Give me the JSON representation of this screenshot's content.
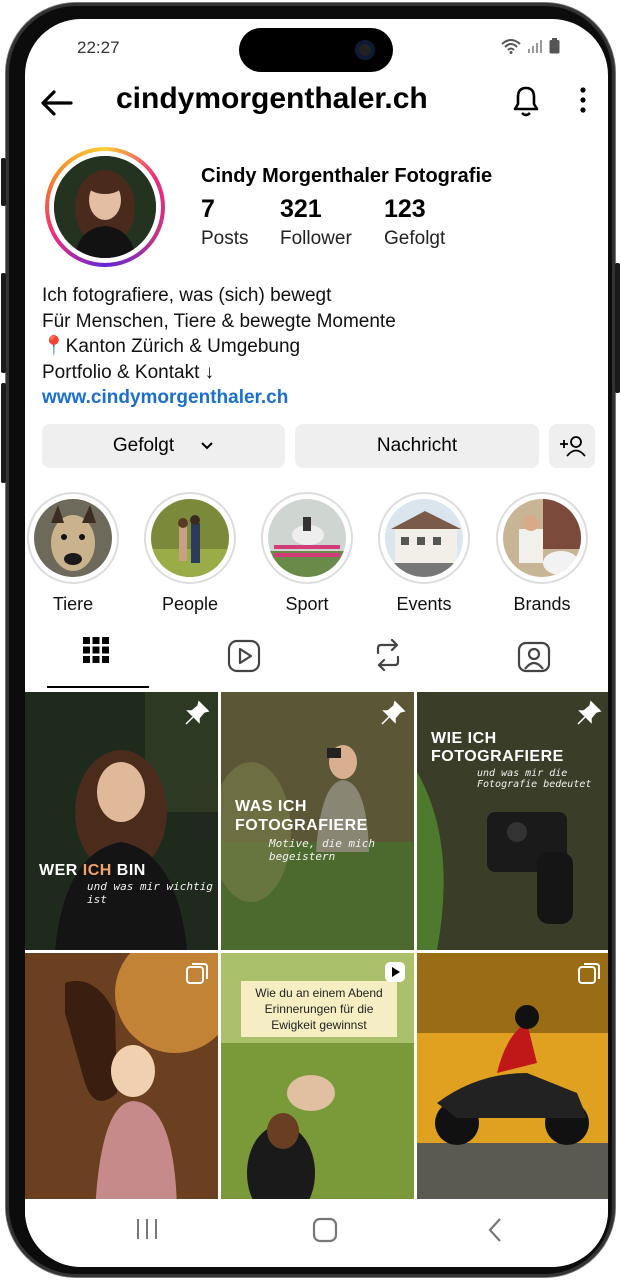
{
  "status": {
    "time": "22:27"
  },
  "header": {
    "username": "cindymorgenthaler.ch"
  },
  "profile": {
    "display_name": "Cindy Morgenthaler Fotografie",
    "stats": [
      {
        "value": "7",
        "label": "Posts"
      },
      {
        "value": "321",
        "label": "Follower"
      },
      {
        "value": "123",
        "label": "Gefolgt"
      }
    ],
    "bio": [
      "Ich fotografiere, was (sich) bewegt",
      "Für Menschen, Tiere & bewegte Momente",
      "📍Kanton Zürich & Umgebung",
      "Portfolio & Kontakt ↓"
    ],
    "link": "www.cindymorgenthaler.ch"
  },
  "actions": {
    "follow_label": "Gefolgt",
    "message_label": "Nachricht"
  },
  "highlights": [
    {
      "label": "Tiere"
    },
    {
      "label": "People"
    },
    {
      "label": "Sport"
    },
    {
      "label": "Events"
    },
    {
      "label": "Brands"
    }
  ],
  "posts": {
    "p2_title_a": "WER ",
    "p2_title_b": "ICH",
    "p2_title_c": " BIN",
    "p2_sub": "und was mir wichtig ist",
    "p3_title_a": "WAS ICH",
    "p3_title_b": "FOTOGRAFIERE",
    "p3_sub": "Motive, die mich begeistern",
    "p4_title_a": "WIE ICH",
    "p4_title_b": "FOTOGRAFIERE",
    "p4_sub": "und was mir die Fotografie bedeutet",
    "p5_caption": "Wie du an einem Abend Erinnerungen für die Ewigkeit gewinnst"
  },
  "colors": {
    "link": "#1a6fd0",
    "accent": "#f0a36b",
    "button_bg": "#efefef"
  }
}
